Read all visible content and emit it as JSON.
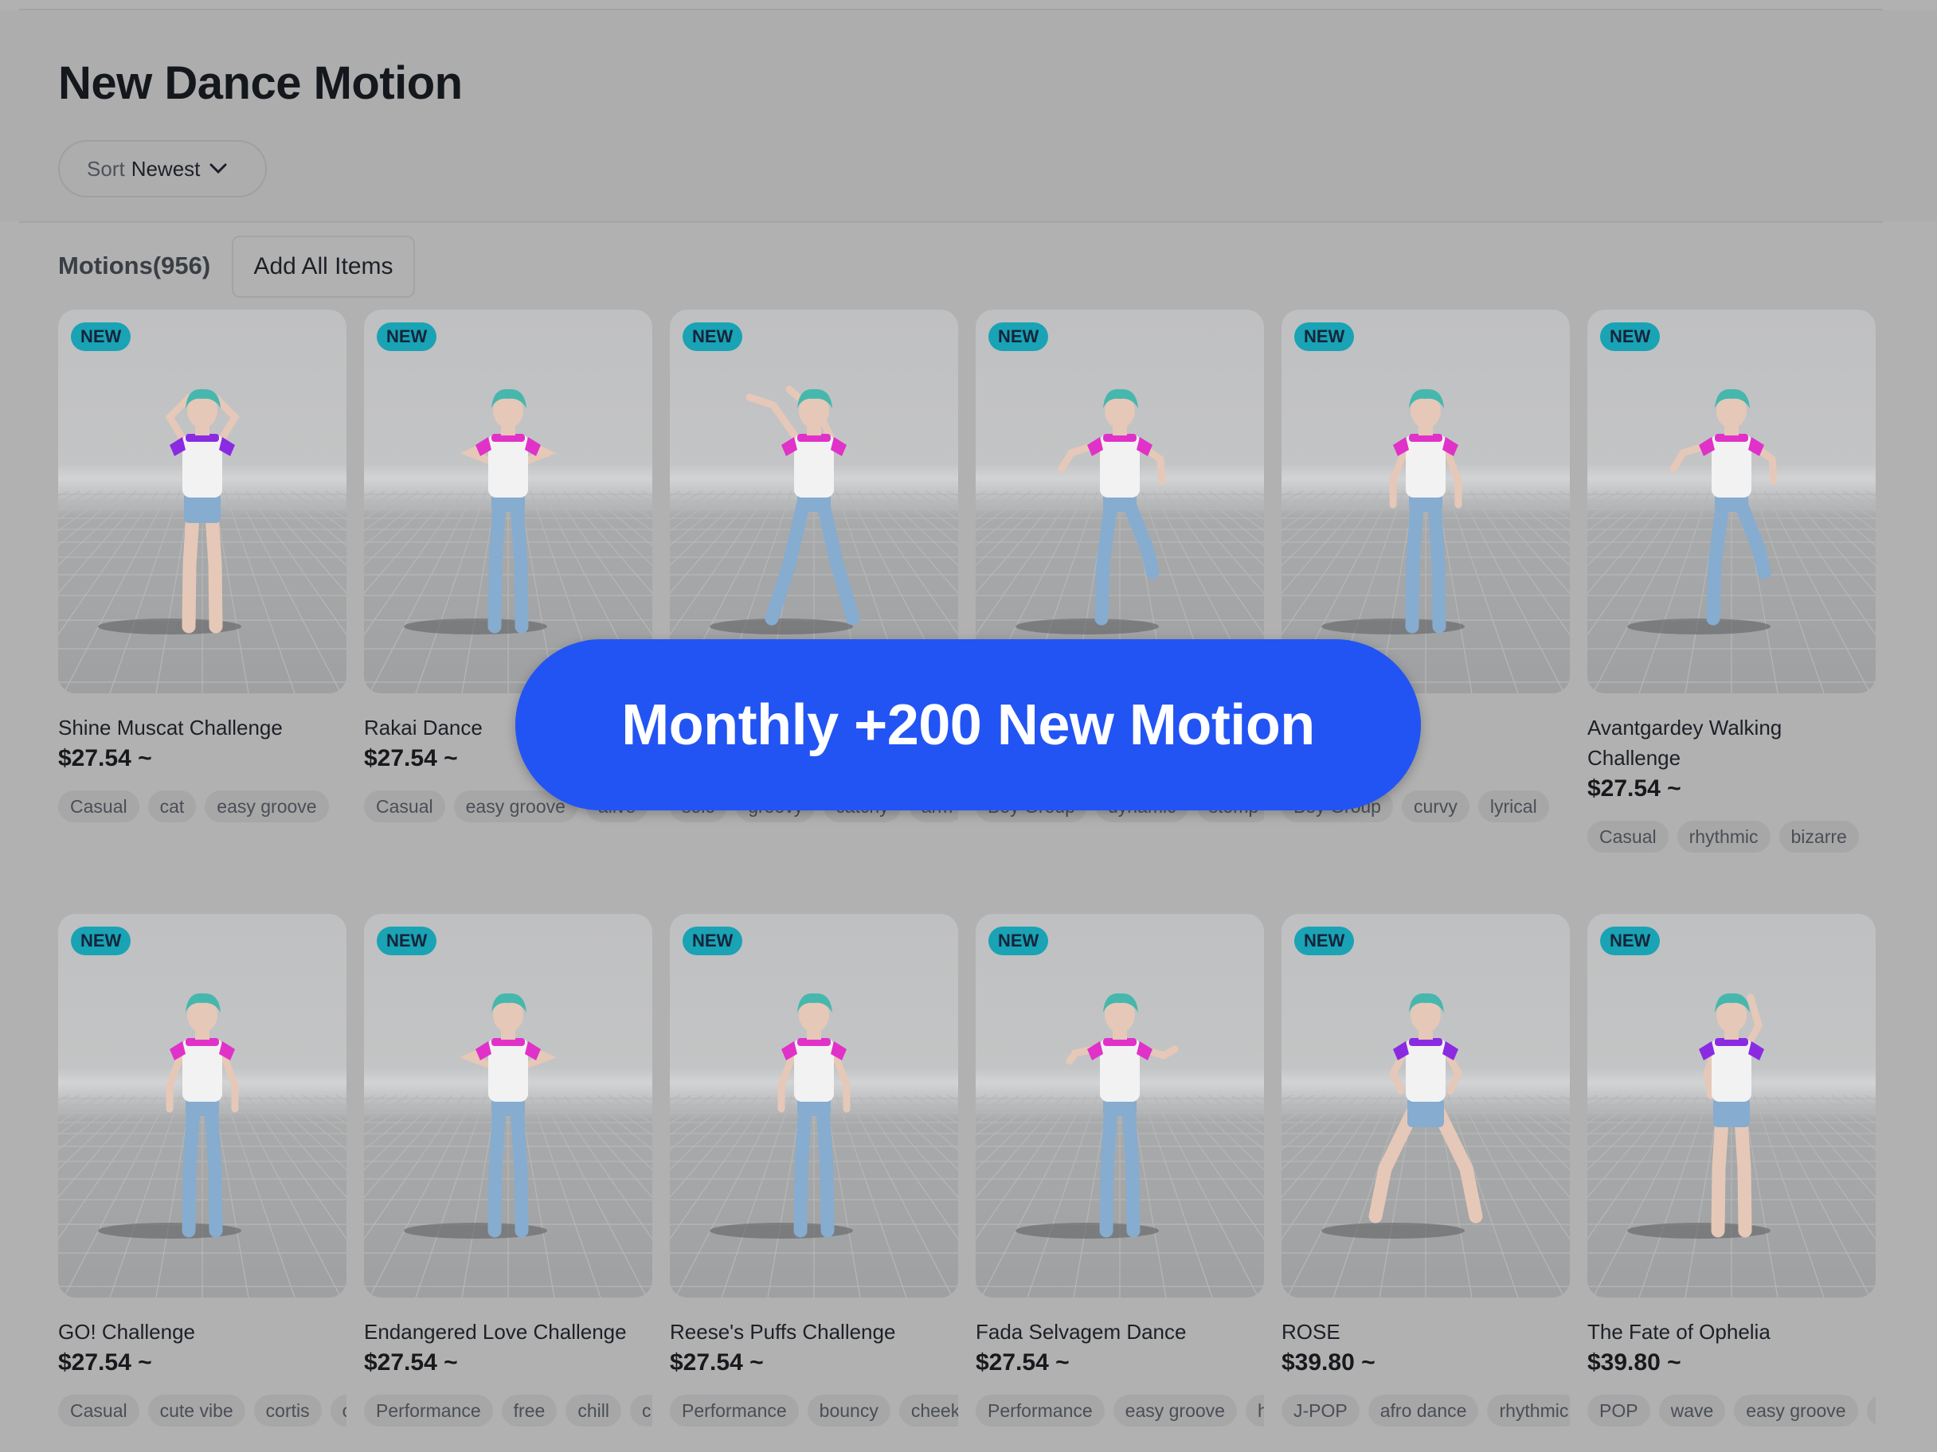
{
  "page": {
    "title": "New Dance Motion"
  },
  "sort": {
    "label": "Sort",
    "value": "Newest"
  },
  "motions": {
    "count_label": "Motions(956)",
    "add_all_label": "Add All Items"
  },
  "promo": {
    "text": "Monthly +200 New Motion"
  },
  "badge_text": "NEW",
  "colors": {
    "badge": "#19a3b5",
    "promo": "#2254f4",
    "shirt_pink": "#e032c8",
    "shirt_purple": "#8a2be2",
    "jeans": "#7fa7c9"
  },
  "cards": [
    {
      "name": "Shine Muscat Challenge",
      "price": "$27.54 ~",
      "tags": [
        "Casual",
        "cat",
        "easy groove"
      ]
    },
    {
      "name": "Rakai Dance",
      "price": "$27.54 ~",
      "tags": [
        "Casual",
        "easy groove",
        "alive"
      ]
    },
    {
      "name": "",
      "price": "",
      "tags": [
        "solo",
        "groovy",
        "catchy",
        "arm"
      ]
    },
    {
      "name": "",
      "price": "",
      "tags": [
        "Boy Group",
        "dynamic",
        "stomp"
      ]
    },
    {
      "name": "",
      "price": "",
      "tags": [
        "Boy Group",
        "curvy",
        "lyrical"
      ]
    },
    {
      "name": "Avantgardey Walking Challenge",
      "price": "$27.54 ~",
      "tags": [
        "Casual",
        "rhythmic",
        "bizarre"
      ]
    },
    {
      "name": "GO! Challenge",
      "price": "$27.54 ~",
      "tags": [
        "Casual",
        "cute vibe",
        "cortis",
        "cute"
      ]
    },
    {
      "name": "Endangered Love Challenge",
      "price": "$27.54 ~",
      "tags": [
        "Performance",
        "free",
        "chill",
        "cute"
      ]
    },
    {
      "name": "Reese's Puffs Challenge",
      "price": "$27.54 ~",
      "tags": [
        "Performance",
        "bouncy",
        "cheeky"
      ]
    },
    {
      "name": "Fada Selvagem Dance",
      "price": "$27.54 ~",
      "tags": [
        "Performance",
        "easy groove",
        "hype"
      ]
    },
    {
      "name": "ROSE",
      "price": "$39.80 ~",
      "tags": [
        "J-POP",
        "afro dance",
        "rhythmic"
      ]
    },
    {
      "name": "The Fate of Ophelia",
      "price": "$39.80 ~",
      "tags": [
        "POP",
        "wave",
        "easy groove",
        "soft"
      ]
    }
  ]
}
